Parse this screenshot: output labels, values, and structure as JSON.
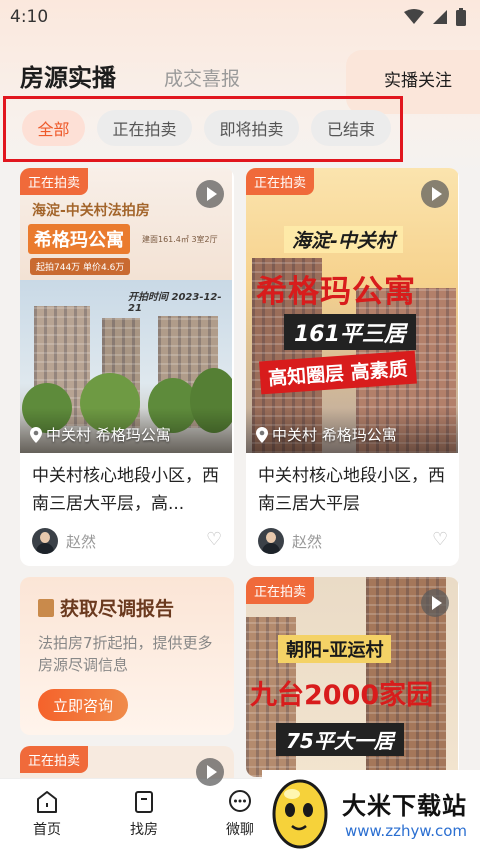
{
  "status_bar": {
    "time": "4:10"
  },
  "header": {
    "title": "房源实播",
    "subtitle": "成交喜报",
    "follow": "实播关注"
  },
  "filters": [
    {
      "label": "全部",
      "active": true
    },
    {
      "label": "正在拍卖",
      "active": false
    },
    {
      "label": "即将拍卖",
      "active": false
    },
    {
      "label": "已结束",
      "active": false
    }
  ],
  "cards": [
    {
      "tag": "正在拍卖",
      "poster": {
        "line1": "海淀-中关村法拍房",
        "line2": "希格玛公寓",
        "area": "建面161.4㎡ 3室2厅",
        "price": "起拍744万 单价4.6万",
        "date": "开拍时间 2023-12-21"
      },
      "location": "中关村 希格玛公寓",
      "title": "中关村核心地段小区，西南三居大平层，高...",
      "agent": "赵然"
    },
    {
      "tag": "正在拍卖",
      "poster": {
        "line1": "海淀-中关村",
        "line2": "希格玛公寓",
        "line3": "161平三居",
        "line4": "高知圈层 高素质"
      },
      "location": "中关村 希格玛公寓",
      "title": "中关村核心地段小区，西南三居大平层",
      "agent": "赵然"
    },
    {
      "tag": "正在拍卖",
      "poster": {
        "line1": "朝阳-亚运村",
        "line2": "九台2000家园",
        "line3": "75平大一居"
      }
    },
    {
      "tag": "正在拍卖"
    }
  ],
  "report": {
    "title": "获取尽调报告",
    "desc": "法拍房7折起拍，提供更多房源尽调信息",
    "button": "立即咨询"
  },
  "nav": [
    {
      "label": "首页",
      "icon": "home-icon"
    },
    {
      "label": "找房",
      "icon": "house-search-icon"
    },
    {
      "label": "微聊",
      "icon": "chat-icon"
    }
  ],
  "watermark": {
    "title": "大米下载站",
    "url": "www.zzhyw.com"
  },
  "colors": {
    "accent": "#f06a3a",
    "highlight_frame": "#e1161e",
    "chip_active_bg": "#fde0d6"
  }
}
